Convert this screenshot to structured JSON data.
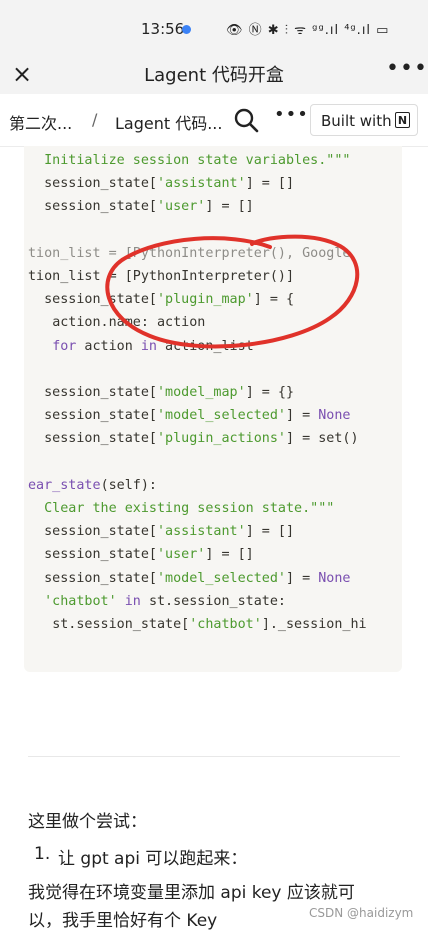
{
  "status_bar": {
    "time": "13:56",
    "icons": "👁 Ⓝ ✱ ⫶ ᯤ ᵍᵍ.ıl ⁴ᵍ.ıl ▭"
  },
  "title_bar": {
    "title": "Lagent 代码开盒",
    "close_icon": "×",
    "more_icon": "•••"
  },
  "breadcrumb": {
    "item1": "第二次...",
    "separator": "/",
    "item2": "Lagent 代码...",
    "more_icon": "•••",
    "built_with_label": "Built with",
    "notion_icon": "N"
  },
  "code": {
    "lines": [
      {
        "pre": "  ",
        "tokens": [
          {
            "t": "Initialize session state variables.\"\"\"",
            "c": "str"
          }
        ]
      },
      {
        "pre": "  ",
        "tokens": [
          {
            "t": "session_state[",
            "c": ""
          },
          {
            "t": "'assistant'",
            "c": "str"
          },
          {
            "t": "] = []",
            "c": ""
          }
        ]
      },
      {
        "pre": "  ",
        "tokens": [
          {
            "t": "session_state[",
            "c": ""
          },
          {
            "t": "'user'",
            "c": "str"
          },
          {
            "t": "] = []",
            "c": ""
          }
        ]
      },
      {
        "pre": "",
        "tokens": [
          {
            "t": "",
            "c": ""
          }
        ]
      },
      {
        "pre": "",
        "tokens": [
          {
            "t": "tion_list = [PythonInterpreter(), Google",
            "c": "faded"
          }
        ]
      },
      {
        "pre": "",
        "tokens": [
          {
            "t": "tion_list = [PythonInterpreter()]",
            "c": ""
          }
        ]
      },
      {
        "pre": "  ",
        "tokens": [
          {
            "t": "session_state[",
            "c": ""
          },
          {
            "t": "'plugin_map'",
            "c": "str"
          },
          {
            "t": "] = {",
            "c": ""
          }
        ]
      },
      {
        "pre": "   ",
        "tokens": [
          {
            "t": "action.name: action",
            "c": ""
          }
        ]
      },
      {
        "pre": "   ",
        "tokens": [
          {
            "t": "for",
            "c": "kw"
          },
          {
            "t": " action ",
            "c": ""
          },
          {
            "t": "in",
            "c": "kw"
          },
          {
            "t": " action_list",
            "c": ""
          }
        ]
      },
      {
        "pre": "",
        "tokens": [
          {
            "t": "",
            "c": ""
          }
        ]
      },
      {
        "pre": "  ",
        "tokens": [
          {
            "t": "session_state[",
            "c": ""
          },
          {
            "t": "'model_map'",
            "c": "str"
          },
          {
            "t": "] = {}",
            "c": ""
          }
        ]
      },
      {
        "pre": "  ",
        "tokens": [
          {
            "t": "session_state[",
            "c": ""
          },
          {
            "t": "'model_selected'",
            "c": "str"
          },
          {
            "t": "] = ",
            "c": ""
          },
          {
            "t": "None",
            "c": "kw"
          }
        ]
      },
      {
        "pre": "  ",
        "tokens": [
          {
            "t": "session_state[",
            "c": ""
          },
          {
            "t": "'plugin_actions'",
            "c": "str"
          },
          {
            "t": "] = set()",
            "c": ""
          }
        ]
      },
      {
        "pre": "",
        "tokens": [
          {
            "t": "",
            "c": ""
          }
        ]
      },
      {
        "pre": "",
        "tokens": [
          {
            "t": "ear_state",
            "c": "kw"
          },
          {
            "t": "(self):",
            "c": ""
          }
        ]
      },
      {
        "pre": "  ",
        "tokens": [
          {
            "t": "Clear the existing session state.\"\"\"",
            "c": "str"
          }
        ]
      },
      {
        "pre": "  ",
        "tokens": [
          {
            "t": "session_state[",
            "c": ""
          },
          {
            "t": "'assistant'",
            "c": "str"
          },
          {
            "t": "] = []",
            "c": ""
          }
        ]
      },
      {
        "pre": "  ",
        "tokens": [
          {
            "t": "session_state[",
            "c": ""
          },
          {
            "t": "'user'",
            "c": "str"
          },
          {
            "t": "] = []",
            "c": ""
          }
        ]
      },
      {
        "pre": "  ",
        "tokens": [
          {
            "t": "session_state[",
            "c": ""
          },
          {
            "t": "'model_selected'",
            "c": "str"
          },
          {
            "t": "] = ",
            "c": ""
          },
          {
            "t": "None",
            "c": "kw"
          }
        ]
      },
      {
        "pre": "  ",
        "tokens": [
          {
            "t": "'chatbot'",
            "c": "str"
          },
          {
            "t": " in ",
            "c": "kw"
          },
          {
            "t": "st.session_state:",
            "c": ""
          }
        ]
      },
      {
        "pre": "   ",
        "tokens": [
          {
            "t": "st.session_state[",
            "c": ""
          },
          {
            "t": "'chatbot'",
            "c": "str"
          },
          {
            "t": "]._session_hi",
            "c": ""
          }
        ]
      }
    ]
  },
  "content": {
    "para1": "这里做个尝试：",
    "list_number": "1.",
    "list_text": "让 gpt api 可以跑起来：",
    "para2_line1": "我觉得在环境变量里添加 api key 应该就可",
    "para2_line2": "以，我手里恰好有个 Key",
    "watermark": "CSDN @haidizym"
  },
  "colors": {
    "string": "#4d9a2f",
    "keyword": "#7a4fb0",
    "annotation": "#e0322a"
  }
}
